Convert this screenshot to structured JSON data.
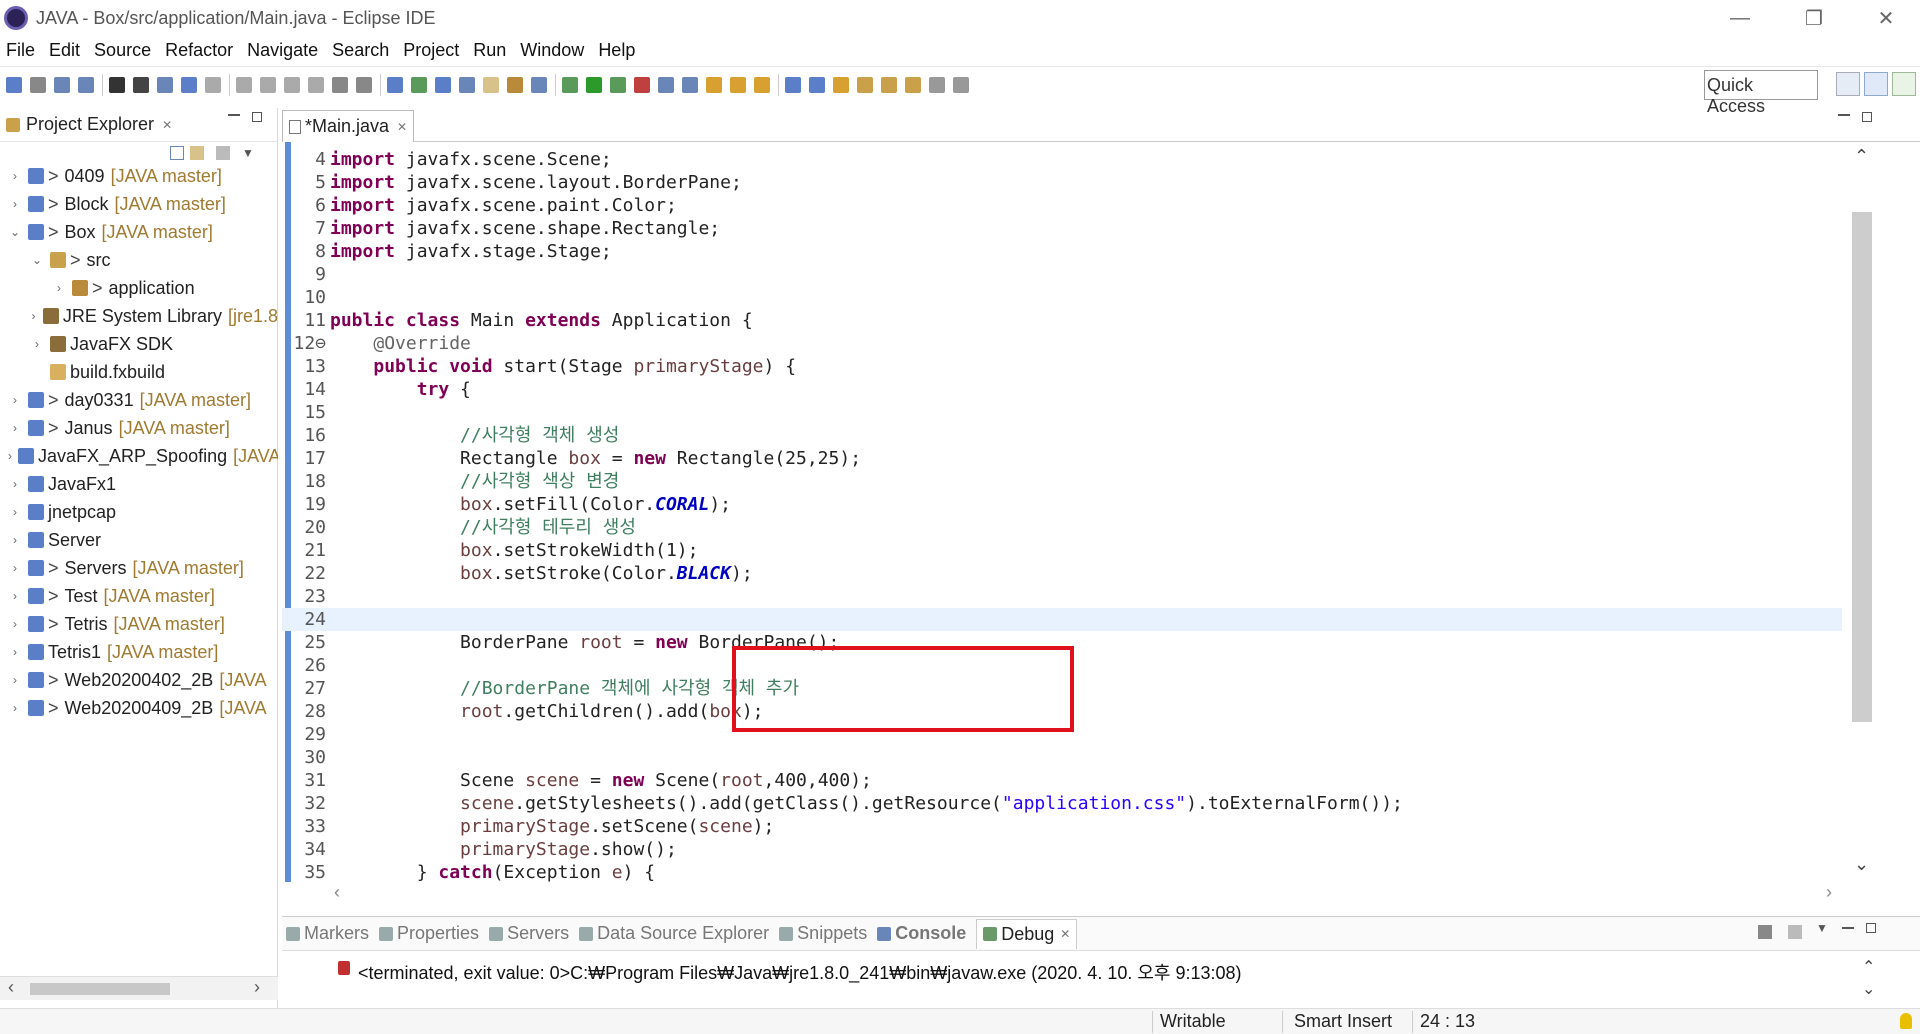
{
  "window": {
    "title": "JAVA - Box/src/application/Main.java - Eclipse IDE",
    "minimize": "—",
    "restore": "❐",
    "close": "✕"
  },
  "menu": [
    "File",
    "Edit",
    "Source",
    "Refactor",
    "Navigate",
    "Search",
    "Project",
    "Run",
    "Window",
    "Help"
  ],
  "toolbar": {
    "quick_access": "Quick Access"
  },
  "explorer": {
    "title": "Project Explorer",
    "close": "✕",
    "items": [
      {
        "arrow": "›",
        "prefix": ">",
        "label": "0409",
        "decor": "[JAVA master]",
        "indent": 0,
        "icon_color": "#5a7fc8"
      },
      {
        "arrow": "›",
        "prefix": ">",
        "label": "Block",
        "decor": "[JAVA master]",
        "indent": 0,
        "icon_color": "#5a7fc8"
      },
      {
        "arrow": "⌄",
        "prefix": ">",
        "label": "Box",
        "decor": "[JAVA master]",
        "indent": 0,
        "icon_color": "#5a7fc8"
      },
      {
        "arrow": "⌄",
        "prefix": ">",
        "label": "src",
        "decor": "",
        "indent": 1,
        "icon_color": "#c9a14a"
      },
      {
        "arrow": "›",
        "prefix": ">",
        "label": "application",
        "decor": "",
        "indent": 2,
        "icon_color": "#b88a3a"
      },
      {
        "arrow": "›",
        "prefix": "",
        "label": "JRE System Library",
        "decor": "[jre1.8",
        "indent": 1,
        "icon_color": "#8a6d3b"
      },
      {
        "arrow": "›",
        "prefix": "",
        "label": "JavaFX SDK",
        "decor": "",
        "indent": 1,
        "icon_color": "#8a6d3b"
      },
      {
        "arrow": "",
        "prefix": "",
        "label": "build.fxbuild",
        "decor": "",
        "indent": 1,
        "icon_color": "#d8b060"
      },
      {
        "arrow": "›",
        "prefix": ">",
        "label": "day0331",
        "decor": "[JAVA master]",
        "indent": 0,
        "icon_color": "#5a7fc8"
      },
      {
        "arrow": "›",
        "prefix": ">",
        "label": "Janus",
        "decor": "[JAVA master]",
        "indent": 0,
        "icon_color": "#5a7fc8"
      },
      {
        "arrow": "›",
        "prefix": "",
        "label": "JavaFX_ARP_Spoofing",
        "decor": "[JAVA",
        "indent": 0,
        "icon_color": "#5a7fc8"
      },
      {
        "arrow": "›",
        "prefix": "",
        "label": "JavaFx1",
        "decor": "",
        "indent": 0,
        "icon_color": "#5a7fc8"
      },
      {
        "arrow": "›",
        "prefix": "",
        "label": "jnetpcap",
        "decor": "",
        "indent": 0,
        "icon_color": "#5a7fc8"
      },
      {
        "arrow": "›",
        "prefix": "",
        "label": "Server",
        "decor": "",
        "indent": 0,
        "icon_color": "#5a7fc8"
      },
      {
        "arrow": "›",
        "prefix": ">",
        "label": "Servers",
        "decor": "[JAVA master]",
        "indent": 0,
        "icon_color": "#5a7fc8"
      },
      {
        "arrow": "›",
        "prefix": ">",
        "label": "Test",
        "decor": "[JAVA master]",
        "indent": 0,
        "icon_color": "#5a7fc8"
      },
      {
        "arrow": "›",
        "prefix": ">",
        "label": "Tetris",
        "decor": "[JAVA master]",
        "indent": 0,
        "icon_color": "#5a7fc8"
      },
      {
        "arrow": "›",
        "prefix": "",
        "label": "Tetris1",
        "decor": "[JAVA master]",
        "indent": 0,
        "icon_color": "#5a7fc8"
      },
      {
        "arrow": "›",
        "prefix": ">",
        "label": "Web20200402_2B",
        "decor": "[JAVA",
        "indent": 0,
        "icon_color": "#5a7fc8"
      },
      {
        "arrow": "›",
        "prefix": ">",
        "label": "Web20200409_2B",
        "decor": "[JAVA",
        "indent": 0,
        "icon_color": "#5a7fc8"
      }
    ],
    "scroll_left": "‹",
    "scroll_right": "›"
  },
  "editor": {
    "tab_label": "*Main.java",
    "tab_close": "✕",
    "current_line": 24,
    "highlighted_lines": [
      20,
      21,
      22
    ],
    "lines": [
      {
        "n": "4",
        "html": "<span class=\"kw\">import</span> javafx.scene.Scene;"
      },
      {
        "n": "5",
        "html": "<span class=\"kw\">import</span> javafx.scene.layout.BorderPane;"
      },
      {
        "n": "6",
        "html": "<span class=\"kw\">import</span> javafx.scene.paint.Color;"
      },
      {
        "n": "7",
        "html": "<span class=\"kw\">import</span> javafx.scene.shape.Rectangle;"
      },
      {
        "n": "8",
        "html": "<span class=\"kw\">import</span> javafx.stage.Stage;"
      },
      {
        "n": "9",
        "html": ""
      },
      {
        "n": "10",
        "html": ""
      },
      {
        "n": "11",
        "html": "<span class=\"kw\">public class</span> Main <span class=\"kw\">extends</span> Application {"
      },
      {
        "n": "12⊖",
        "html": "    <span class=\"ann\">@Override</span>"
      },
      {
        "n": "13",
        "html": "    <span class=\"kw\">public void</span> start(Stage <span class=\"vr\">primaryStage</span>) {"
      },
      {
        "n": "14",
        "html": "        <span class=\"kw\">try</span> {"
      },
      {
        "n": "15",
        "html": ""
      },
      {
        "n": "16",
        "html": "            <span class=\"cm\">//사각형 객체 생성</span>"
      },
      {
        "n": "17",
        "html": "            Rectangle <span class=\"vr\">box</span> = <span class=\"kw\">new</span> Rectangle(25,25);"
      },
      {
        "n": "18",
        "html": "            <span class=\"cm\">//사각형 색상 변경</span>"
      },
      {
        "n": "19",
        "html": "            <span class=\"vr\">box</span>.setFill(Color.<span class=\"cst\">CORAL</span>);"
      },
      {
        "n": "20",
        "html": "            <span class=\"cm\">//사각형 테두리 생성</span>"
      },
      {
        "n": "21",
        "html": "            <span class=\"vr\">box</span>.setStrokeWidth(1);"
      },
      {
        "n": "22",
        "html": "            <span class=\"vr\">box</span>.setStroke(Color.<span class=\"cst\">BLACK</span>);"
      },
      {
        "n": "23",
        "html": ""
      },
      {
        "n": "24",
        "html": ""
      },
      {
        "n": "25",
        "html": "            BorderPane <span class=\"vr\">root</span> = <span class=\"kw\">new</span> BorderPane();"
      },
      {
        "n": "26",
        "html": ""
      },
      {
        "n": "27",
        "html": "            <span class=\"cm\">//BorderPane 객체에 사각형 객체 추가</span>"
      },
      {
        "n": "28",
        "html": "            <span class=\"vr\">root</span>.getChildren().add(<span class=\"vr\">box</span>);"
      },
      {
        "n": "29",
        "html": ""
      },
      {
        "n": "30",
        "html": ""
      },
      {
        "n": "31",
        "html": "            Scene <span class=\"vr\">scene</span> = <span class=\"kw\">new</span> Scene(<span class=\"vr\">root</span>,400,400);"
      },
      {
        "n": "32",
        "html": "            <span class=\"vr\">scene</span>.getStylesheets().add(getClass().getResource(<span class=\"str\">\"application.css\"</span>).toExternalForm());"
      },
      {
        "n": "33",
        "html": "            <span class=\"vr\">primaryStage</span>.setScene(<span class=\"vr\">scene</span>);"
      },
      {
        "n": "34",
        "html": "            <span class=\"vr\">primaryStage</span>.show();"
      },
      {
        "n": "35",
        "html": "        } <span class=\"kw\">catch</span>(Exception <span class=\"vr\">e</span>) {"
      }
    ],
    "scroll_up": "⌃",
    "scroll_down": "⌄",
    "hscroll_left": "‹",
    "hscroll_right": "›"
  },
  "console": {
    "tabs": [
      {
        "label": "Markers",
        "active": false,
        "icon_color": "#9aa"
      },
      {
        "label": "Properties",
        "active": false,
        "icon_color": "#9aa"
      },
      {
        "label": "Servers",
        "active": false,
        "icon_color": "#9aa"
      },
      {
        "label": "Data Source Explorer",
        "active": false,
        "icon_color": "#9aa"
      },
      {
        "label": "Snippets",
        "active": false,
        "icon_color": "#9aa"
      },
      {
        "label": "Console",
        "active": false,
        "icon_color": "#6a86b8",
        "bold": true
      },
      {
        "label": "Debug",
        "active": true,
        "icon_color": "#6a9a6a"
      }
    ],
    "debug_close": "✕",
    "message": "<terminated, exit value: 0>C:₩Program Files₩Java₩jre1.8.0_241₩bin₩javaw.exe (2020. 4. 10. 오후 9:13:08)"
  },
  "status": {
    "mode": "Writable",
    "insert": "Smart Insert",
    "position": "24 : 13"
  }
}
